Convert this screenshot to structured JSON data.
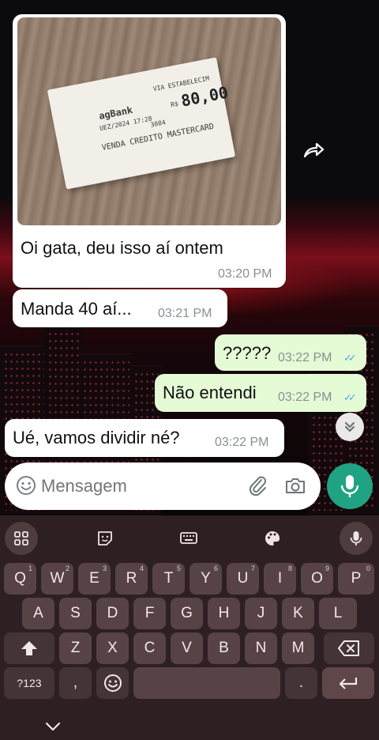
{
  "chat": {
    "messages": [
      {
        "direction": "incoming",
        "text": "Oi gata, deu isso aí ontem",
        "time": "03:20 PM",
        "has_photo": true
      },
      {
        "direction": "incoming",
        "text": "Manda 40 aí...",
        "time": "03:21 PM"
      },
      {
        "direction": "outgoing",
        "text": "?????",
        "time": "03:22 PM",
        "status": "read"
      },
      {
        "direction": "outgoing",
        "text": "Não entendi",
        "time": "03:22 PM",
        "status": "read"
      },
      {
        "direction": "incoming",
        "text": "Ué, vamos dividir né?",
        "time": "03:22 PM"
      }
    ],
    "photo_receipt": {
      "bank": "agBank",
      "line_via": "VIA ESTABELECIM",
      "line_date": "UEZ/2024 17:28",
      "line_sale": "VENDA CREDITO MASTERCARD",
      "line_num": "3084",
      "amount": "80,00",
      "currency_prefix": "R$"
    },
    "forward_icon": "forward-icon",
    "scroll_down_icon": "double-chevron-down-icon"
  },
  "input": {
    "placeholder": "Mensagem",
    "emoji_icon": "emoji-icon",
    "attach_icon": "paperclip-icon",
    "camera_icon": "camera-icon",
    "mic_icon": "microphone-icon"
  },
  "keyboard": {
    "toolbar": [
      "apps-grid-icon",
      "sticker-icon",
      "keyboard-icon",
      "palette-icon",
      "microphone-icon"
    ],
    "row1": [
      {
        "k": "Q",
        "n": "1"
      },
      {
        "k": "W",
        "n": "2"
      },
      {
        "k": "E",
        "n": "3"
      },
      {
        "k": "R",
        "n": "4"
      },
      {
        "k": "T",
        "n": "5"
      },
      {
        "k": "Y",
        "n": "6"
      },
      {
        "k": "U",
        "n": "7"
      },
      {
        "k": "I",
        "n": "8"
      },
      {
        "k": "O",
        "n": "9"
      },
      {
        "k": "P",
        "n": "0"
      }
    ],
    "row2": [
      "A",
      "S",
      "D",
      "F",
      "G",
      "H",
      "J",
      "K",
      "L"
    ],
    "row3": [
      "Z",
      "X",
      "C",
      "V",
      "B",
      "N",
      "M"
    ],
    "symbols_key": "?123",
    "comma_key": ",",
    "period_key": ".",
    "shift_icon": "shift-icon",
    "backspace_icon": "backspace-icon",
    "enter_icon": "enter-icon",
    "emoji_icon": "emoji-icon",
    "collapse_icon": "chevron-down-icon"
  },
  "colors": {
    "incoming_bubble": "#ffffff",
    "outgoing_bubble": "#e5fbd6",
    "mic_button": "#1fa383",
    "read_ticks": "#4aa8e8",
    "keyboard_bg": "#2e1f22",
    "key_bg": "#574346"
  }
}
